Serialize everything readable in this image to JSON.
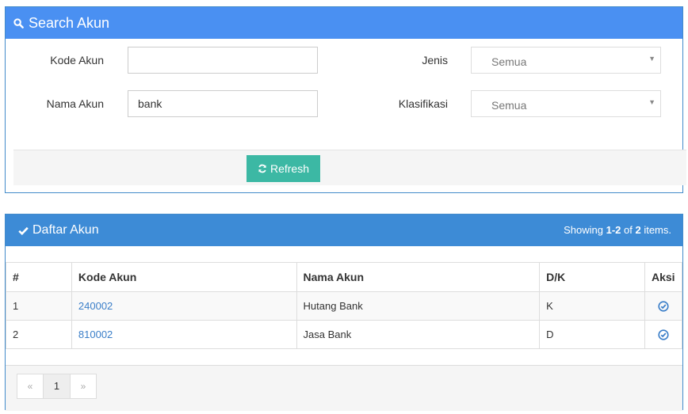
{
  "search_panel": {
    "title": "Search Akun",
    "kode_akun": {
      "label": "Kode Akun",
      "value": ""
    },
    "nama_akun": {
      "label": "Nama Akun",
      "value": "bank"
    },
    "jenis": {
      "label": "Jenis",
      "selected": "Semua"
    },
    "klasifikasi": {
      "label": "Klasifikasi",
      "selected": "Semua"
    },
    "refresh_label": "Refresh",
    "heading_color": "#4a90f2",
    "button_color": "#3cb8a4"
  },
  "list_panel": {
    "title": "Daftar Akun",
    "summary": {
      "prefix": "Showing ",
      "range": "1-2",
      "mid": " of ",
      "total": "2",
      "suffix": " items."
    },
    "columns": [
      "#",
      "Kode Akun",
      "Nama Akun",
      "D/K",
      "Aksi"
    ],
    "rows": [
      {
        "no": "1",
        "kode": "240002",
        "nama": "Hutang Bank",
        "dk": "K",
        "aksi_icon": "check-circle-icon"
      },
      {
        "no": "2",
        "kode": "810002",
        "nama": "Jasa Bank",
        "dk": "D",
        "aksi_icon": "check-circle-icon"
      }
    ],
    "pagination": {
      "prev": "«",
      "page": "1",
      "next": "»"
    },
    "heading_color": "#3d8bd6",
    "link_color": "#3a7ec8"
  }
}
